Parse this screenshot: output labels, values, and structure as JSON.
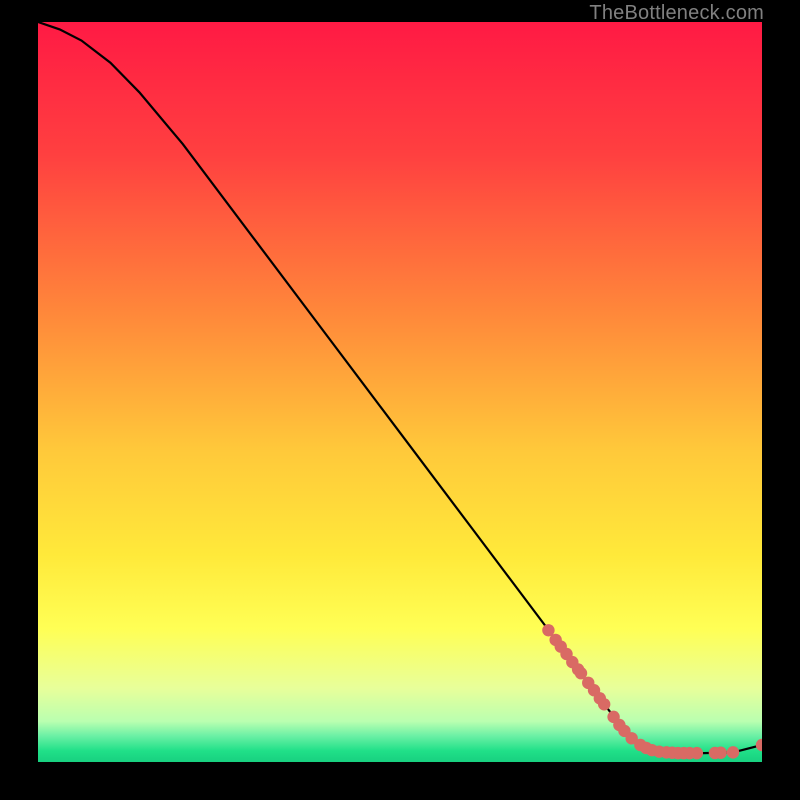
{
  "attribution": "TheBottleneck.com",
  "chart_data": {
    "type": "line",
    "xlabel": "",
    "ylabel": "",
    "title": "",
    "xlim": [
      0,
      100
    ],
    "ylim": [
      0,
      100
    ],
    "gradient_stops": [
      {
        "offset": 0.0,
        "color": "#ff1a44"
      },
      {
        "offset": 0.18,
        "color": "#ff4040"
      },
      {
        "offset": 0.4,
        "color": "#ff8a3a"
      },
      {
        "offset": 0.58,
        "color": "#ffc93a"
      },
      {
        "offset": 0.72,
        "color": "#ffe93a"
      },
      {
        "offset": 0.82,
        "color": "#ffff55"
      },
      {
        "offset": 0.9,
        "color": "#e8ff9a"
      },
      {
        "offset": 0.945,
        "color": "#baffb0"
      },
      {
        "offset": 0.965,
        "color": "#6af0a5"
      },
      {
        "offset": 0.985,
        "color": "#20e088"
      },
      {
        "offset": 1.0,
        "color": "#18d080"
      }
    ],
    "curve": [
      {
        "x": 0.0,
        "y": 100.0
      },
      {
        "x": 3.0,
        "y": 99.0
      },
      {
        "x": 6.0,
        "y": 97.5
      },
      {
        "x": 10.0,
        "y": 94.5
      },
      {
        "x": 14.0,
        "y": 90.5
      },
      {
        "x": 20.0,
        "y": 83.5
      },
      {
        "x": 30.0,
        "y": 70.5
      },
      {
        "x": 40.0,
        "y": 57.5
      },
      {
        "x": 50.0,
        "y": 44.5
      },
      {
        "x": 60.0,
        "y": 31.5
      },
      {
        "x": 70.0,
        "y": 18.5
      },
      {
        "x": 80.0,
        "y": 5.5
      },
      {
        "x": 83.0,
        "y": 2.3
      },
      {
        "x": 85.0,
        "y": 1.4
      },
      {
        "x": 88.0,
        "y": 1.2
      },
      {
        "x": 92.0,
        "y": 1.2
      },
      {
        "x": 96.0,
        "y": 1.3
      },
      {
        "x": 100.0,
        "y": 2.3
      }
    ],
    "series": [
      {
        "name": "data-points",
        "color": "#d96a64",
        "points": [
          {
            "x": 70.5,
            "y": 17.8
          },
          {
            "x": 71.5,
            "y": 16.5
          },
          {
            "x": 72.2,
            "y": 15.6
          },
          {
            "x": 73.0,
            "y": 14.6
          },
          {
            "x": 73.8,
            "y": 13.5
          },
          {
            "x": 74.6,
            "y": 12.5
          },
          {
            "x": 75.0,
            "y": 12.0
          },
          {
            "x": 76.0,
            "y": 10.7
          },
          {
            "x": 76.8,
            "y": 9.7
          },
          {
            "x": 77.6,
            "y": 8.6
          },
          {
            "x": 78.2,
            "y": 7.8
          },
          {
            "x": 79.5,
            "y": 6.1
          },
          {
            "x": 80.3,
            "y": 5.0
          },
          {
            "x": 81.0,
            "y": 4.2
          },
          {
            "x": 82.0,
            "y": 3.2
          },
          {
            "x": 83.2,
            "y": 2.3
          },
          {
            "x": 84.0,
            "y": 1.9
          },
          {
            "x": 84.8,
            "y": 1.6
          },
          {
            "x": 85.8,
            "y": 1.4
          },
          {
            "x": 86.8,
            "y": 1.3
          },
          {
            "x": 87.6,
            "y": 1.25
          },
          {
            "x": 88.4,
            "y": 1.2
          },
          {
            "x": 89.2,
            "y": 1.2
          },
          {
            "x": 90.0,
            "y": 1.2
          },
          {
            "x": 91.0,
            "y": 1.2
          },
          {
            "x": 93.5,
            "y": 1.22
          },
          {
            "x": 94.3,
            "y": 1.25
          },
          {
            "x": 96.0,
            "y": 1.3
          },
          {
            "x": 100.0,
            "y": 2.3
          }
        ]
      }
    ]
  }
}
